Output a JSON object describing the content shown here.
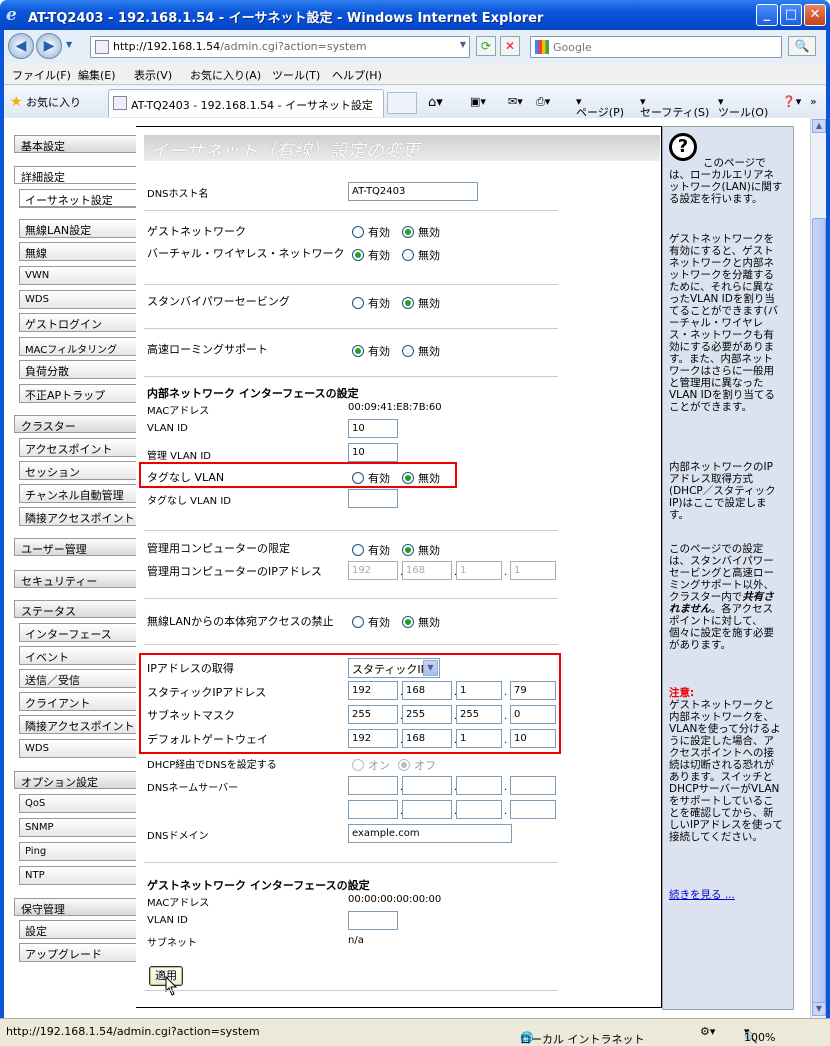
{
  "window": {
    "title": "AT-TQ2403 - 192.168.1.54 - イーサネット設定 - Windows Internet Explorer",
    "minimize": "_",
    "maximize": "□",
    "close": "✕"
  },
  "browser": {
    "url_host": "http://192.168.1.54",
    "url_path": "/admin.cgi?action=system",
    "search_placeholder": "Google",
    "menu": [
      "ファイル(F)",
      "編集(E)",
      "表示(V)",
      "お気に入り(A)",
      "ツール(T)",
      "ヘルプ(H)"
    ],
    "favorites": "お気に入り",
    "tab_title": "AT-TQ2403 - 192.168.1.54 - イーサネット設定",
    "tools": {
      "page": "ページ(P)",
      "safety": "セーフティ(S)",
      "tool": "ツール(O)"
    },
    "status_url": "http://192.168.1.54/admin.cgi?action=system",
    "zone": "ローカル イントラネット",
    "zoom": "100%"
  },
  "sidebar": {
    "basic": "基本設定",
    "advanced": "詳細設定",
    "ethernet": "イーサネット設定",
    "wireless_lan": "無線LAN設定",
    "wireless": "無線",
    "vwn": "VWN",
    "wds": "WDS",
    "guest_login": "ゲストログイン",
    "mac_filter": "MACフィルタリング",
    "load_balance": "負荷分散",
    "rogue_ap": "不正APトラップ",
    "cluster": "クラスター",
    "access_point": "アクセスポイント",
    "session": "セッション",
    "channel": "チャンネル自動管理",
    "neighbor_ap": "隣接アクセスポイント",
    "user_mgmt": "ユーザー管理",
    "security": "セキュリティー",
    "status": "ステータス",
    "interface": "インターフェース",
    "event": "イベント",
    "tx_rx": "送信／受信",
    "client": "クライアント",
    "neighbor_ap2": "隣接アクセスポイント",
    "wds2": "WDS",
    "options": "オプション設定",
    "qos": "QoS",
    "snmp": "SNMP",
    "ping": "Ping",
    "ntp": "NTP",
    "maintenance": "保守管理",
    "settings": "設定",
    "upgrade": "アップグレード"
  },
  "main": {
    "title": "イーサネット（有線）設定の変更",
    "radio_on": "有効",
    "radio_off": "無効",
    "dns_host_label": "DNSホスト名",
    "dns_host_value": "AT-TQ2403",
    "guest_network": "ゲストネットワーク",
    "virtual_wireless": "バーチャル・ワイヤレス・ネットワーク",
    "standby": "スタンバイパワーセービング",
    "fast_roaming": "高速ローミングサポート",
    "internal_header": "内部ネットワーク インターフェースの設定",
    "mac_label": "MACアドレス",
    "mac_value": "00:09:41:E8:7B:60",
    "vlan_id_label": "VLAN ID",
    "vlan_id_value": "10",
    "mgmt_vlan_label": "管理 VLAN ID",
    "mgmt_vlan_value": "10",
    "untagged_vlan": "タグなし VLAN",
    "untagged_vlan_id": "タグなし VLAN ID",
    "untagged_vlan_id_value": "",
    "mgmt_pc_limit": "管理用コンピューターの限定",
    "mgmt_pc_ip": "管理用コンピューターのIPアドレス",
    "mgmt_ip": [
      "192",
      "168",
      "1",
      "1"
    ],
    "wireless_access_ban": "無線LANからの本体宛アクセスの禁止",
    "ip_acquire": "IPアドレスの取得",
    "ip_acquire_value": "スタティックIP",
    "static_ip_label": "スタティックIPアドレス",
    "static_ip": [
      "192",
      "168",
      "1",
      "79"
    ],
    "subnet_label": "サブネットマスク",
    "subnet": [
      "255",
      "255",
      "255",
      "0"
    ],
    "gateway_label": "デフォルトゲートウェイ",
    "gateway": [
      "192",
      "168",
      "1",
      "10"
    ],
    "dhcp_dns_label": "DHCP経由でDNSを設定する",
    "dhcp_on": "オン",
    "dhcp_off": "オフ",
    "dns_server_label": "DNSネームサーバー",
    "dns_domain_label": "DNSドメイン",
    "dns_domain_value": "example.com",
    "guest_header": "ゲストネットワーク インターフェースの設定",
    "guest_mac_label": "MACアドレス",
    "guest_mac_value": "00:00:00:00:00:00",
    "guest_vlan_label": "VLAN ID",
    "guest_vlan_value": "",
    "guest_subnet_label": "サブネット",
    "guest_subnet_value": "n/a",
    "apply": "適用"
  },
  "help": {
    "p1": "このページでは、ローカルエリアネットワーク(LAN)に関する設定を行います。",
    "p2": "ゲストネットワークを有効にすると、ゲストネットワークと内部ネットワークを分離するために、それらに異なったVLAN IDを割り当てることができます(バーチャル・ワイヤレス・ネットワークも有効にする必要があります。また、内部ネットワークはさらに一般用と管理用に異なったVLAN IDを割り当てることができます。",
    "p3": "内部ネットワークのIPアドレス取得方式(DHCP／スタティックIP)はここで設定します。",
    "p4a": "このページでの設定は、スタンバイパワーセービングと高速ローミングサポート以外、クラスター内で",
    "p4b": "共有されません",
    "p4c": "。各アクセスポイントに対して、個々に設定を施す必要があります。",
    "warn": "注意:",
    "p5": "ゲストネットワークと内部ネットワークを、VLANを使って分けるように設定した場合、アクセスポイントへの接続は切断される恐れがあります。スイッチとDHCPサーバーがVLANをサポートしていることを確認してから、新しいIPアドレスを使って接続してください。",
    "more": "続きを見る ..."
  }
}
